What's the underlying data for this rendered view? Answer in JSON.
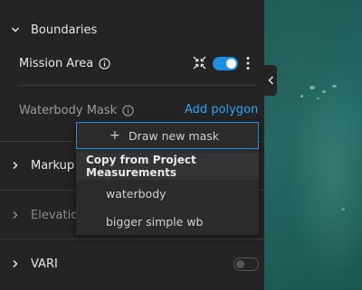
{
  "sections": {
    "boundaries": {
      "title": "Boundaries"
    },
    "markup": {
      "title": "Markup"
    },
    "elevation": {
      "title": "Elevation"
    },
    "vari": {
      "title": "VARI"
    }
  },
  "mission_area": {
    "label": "Mission Area",
    "toggle_on": true
  },
  "waterbody_mask": {
    "label": "Waterbody Mask",
    "add_polygon": "Add polygon"
  },
  "mask_dropdown": {
    "draw_new": "Draw new mask",
    "plus": "+",
    "heading": "Copy from Project Measurements",
    "items": [
      "waterbody",
      "bigger simple wb"
    ]
  },
  "vari_toggle_on": false,
  "colors": {
    "accent": "#1a8fe6",
    "link": "#2aa4f4",
    "panel_bg": "#242424",
    "map": "#1e5a56"
  },
  "icons": {
    "chevron_down": "chevron-down-icon",
    "chevron_right": "chevron-right-icon",
    "info": "info-icon",
    "collapse_arrows": "collapse-arrows-icon",
    "more": "more-vertical-icon",
    "collapse_panel": "chevron-left-icon"
  }
}
